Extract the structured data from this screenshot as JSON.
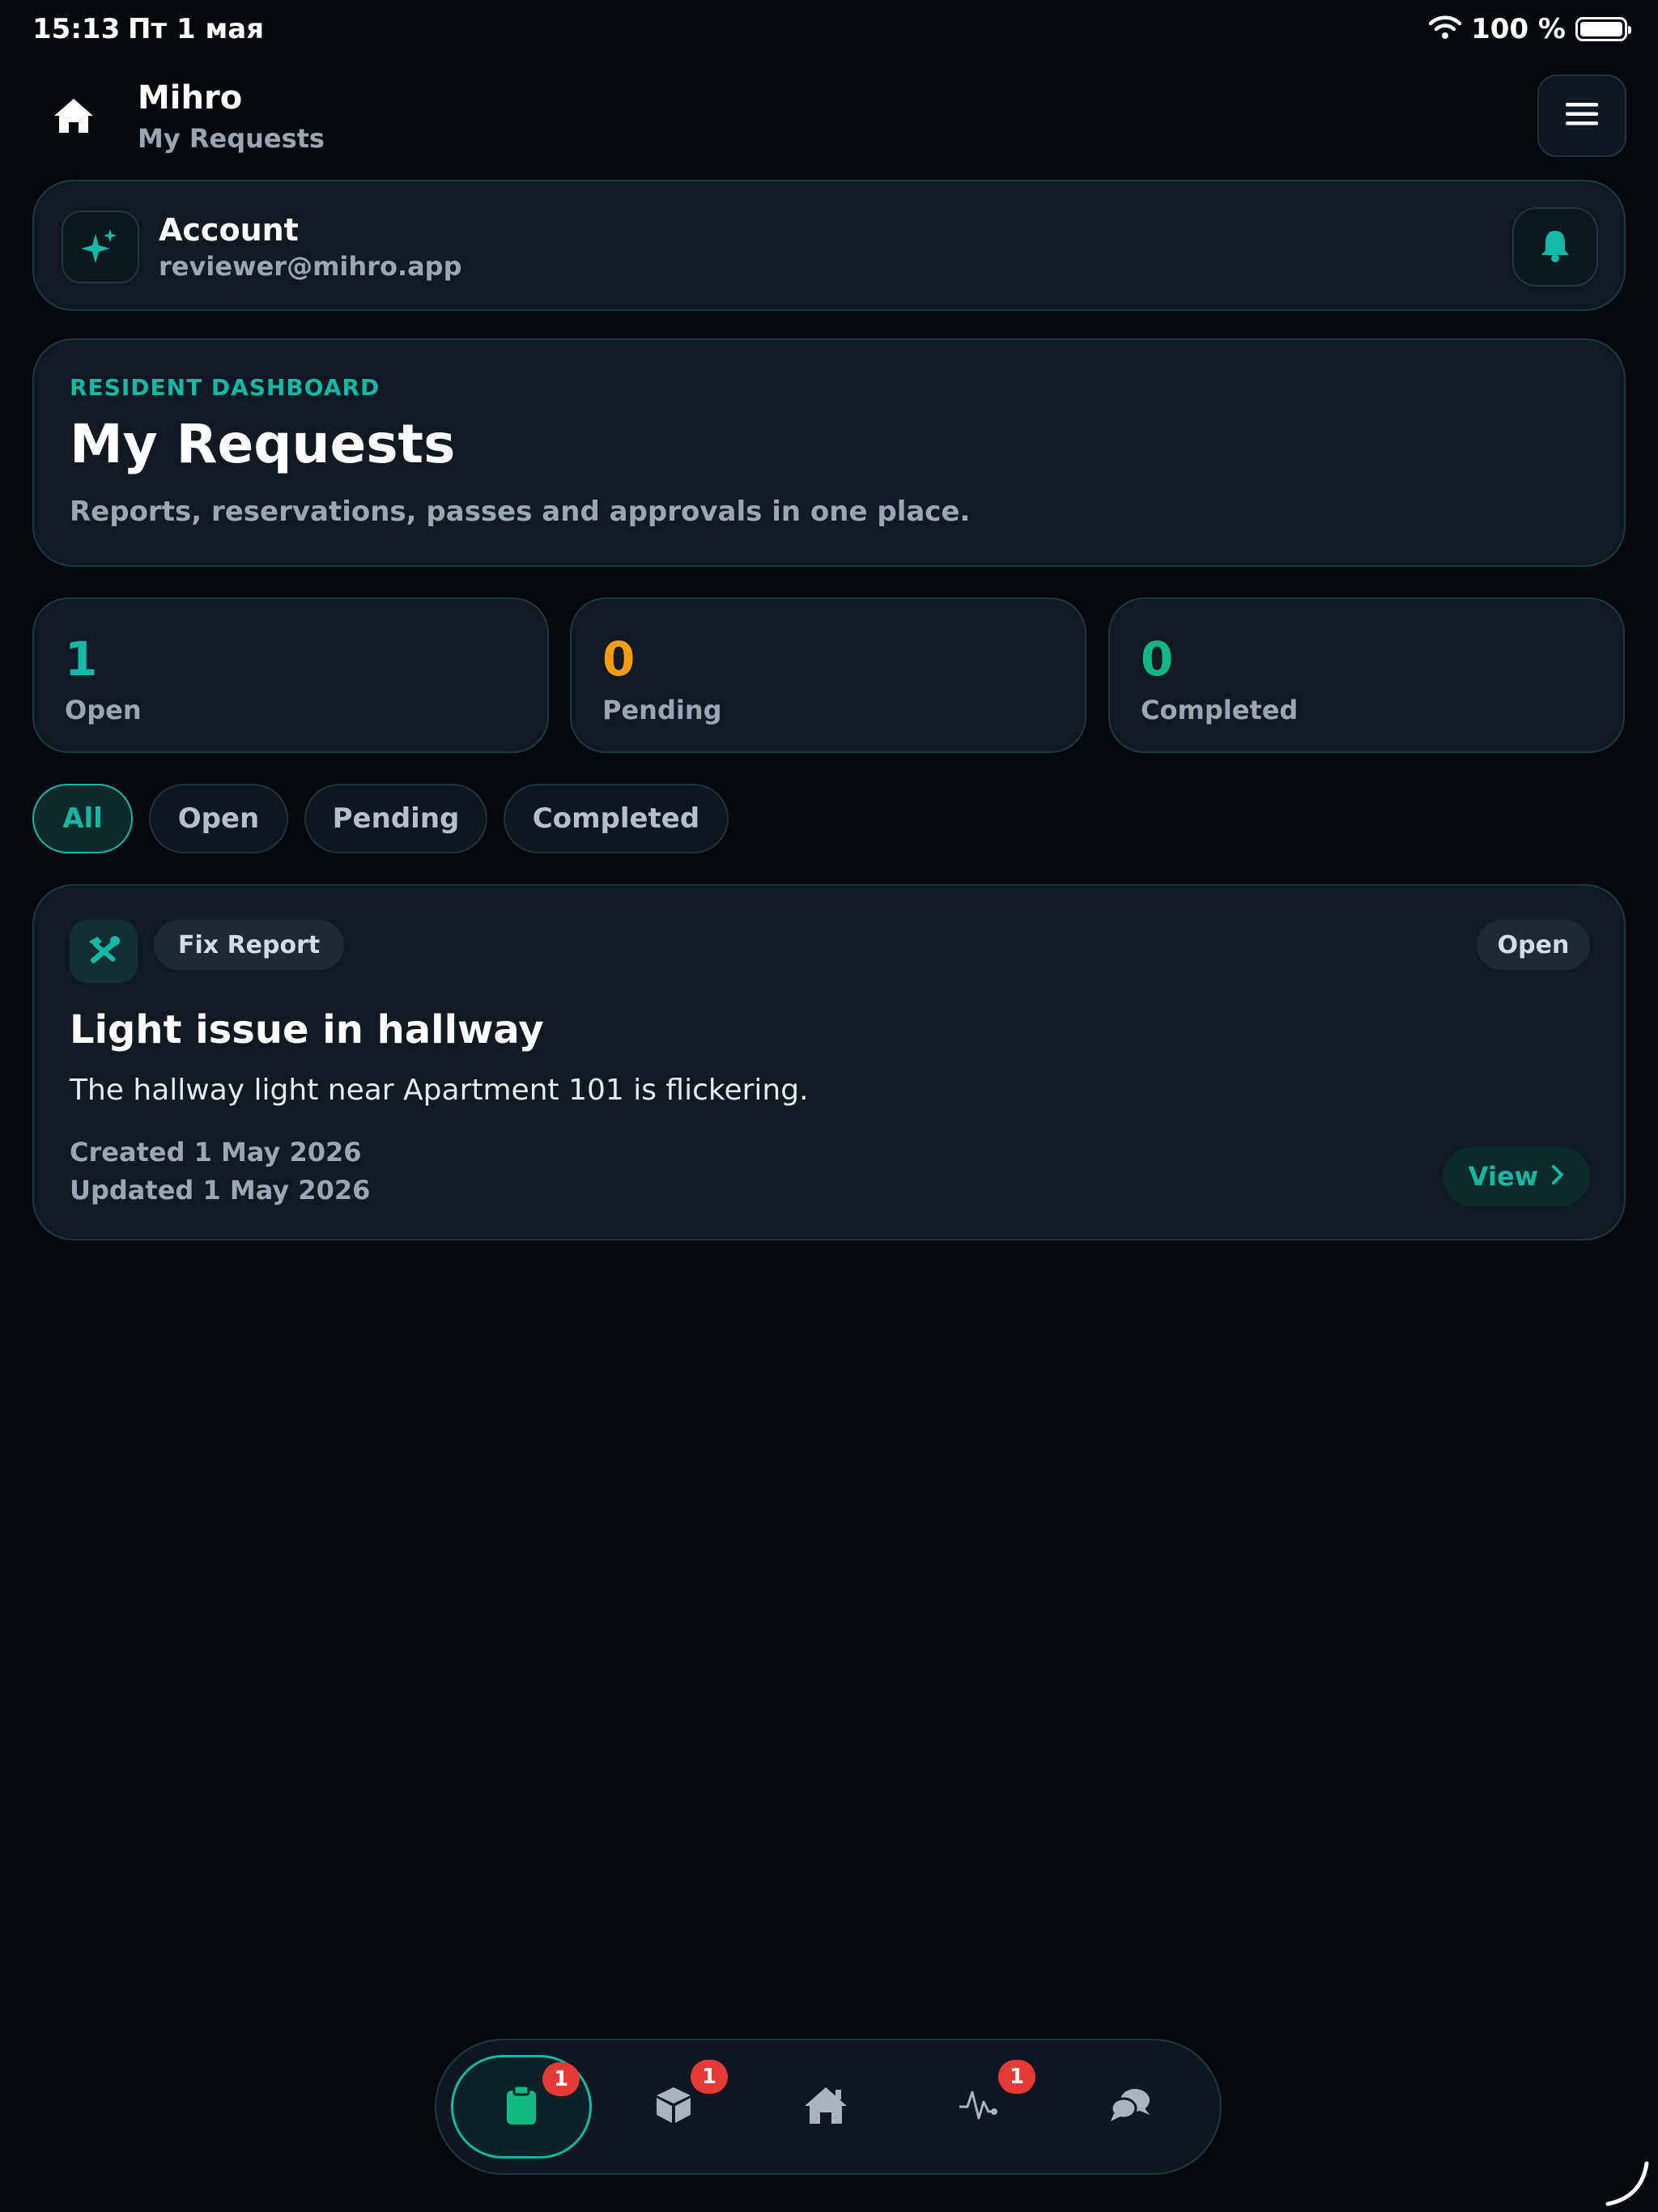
{
  "status_bar": {
    "time": "15:13",
    "date": "Пт 1 мая",
    "battery": "100 %"
  },
  "header": {
    "app_name": "Mihro",
    "subtitle": "My Requests"
  },
  "account": {
    "title": "Account",
    "email": "reviewer@mihro.app"
  },
  "hero": {
    "eyebrow": "RESIDENT DASHBOARD",
    "title": "My Requests",
    "description": "Reports, reservations, passes and approvals in one place."
  },
  "stats": [
    {
      "value": "1",
      "label": "Open",
      "color": "#14b8a6"
    },
    {
      "value": "0",
      "label": "Pending",
      "color": "#f59e0b"
    },
    {
      "value": "0",
      "label": "Completed",
      "color": "#10b981"
    }
  ],
  "filters": [
    {
      "label": "All",
      "active": true
    },
    {
      "label": "Open",
      "active": false
    },
    {
      "label": "Pending",
      "active": false
    },
    {
      "label": "Completed",
      "active": false
    }
  ],
  "request": {
    "type": "Fix Report",
    "type_icon": "tools-icon",
    "status": "Open",
    "title": "Light issue in hallway",
    "description": "The hallway light near Apartment 101 is flickering.",
    "created": "Created 1 May 2026",
    "updated": "Updated 1 May 2026",
    "view_label": "View"
  },
  "bottom_nav": [
    {
      "icon": "clipboard-icon",
      "badge": "1",
      "active": true
    },
    {
      "icon": "package-icon",
      "badge": "1",
      "active": false
    },
    {
      "icon": "home-icon",
      "badge": null,
      "active": false
    },
    {
      "icon": "activity-icon",
      "badge": "1",
      "active": false
    },
    {
      "icon": "chat-icon",
      "badge": null,
      "active": false
    }
  ],
  "colors": {
    "accent": "#14b8a6",
    "pending": "#f59e0b",
    "completed": "#10b981",
    "badge": "#e53935"
  }
}
